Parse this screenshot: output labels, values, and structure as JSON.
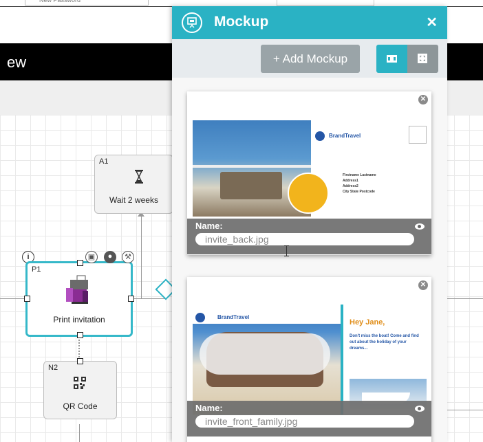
{
  "topbar": {
    "field_fragment": "New Password"
  },
  "background_view": {
    "title_fragment": "ew"
  },
  "nodes": {
    "wait": {
      "code": "A1",
      "label": "Wait 2 weeks"
    },
    "print": {
      "code": "P1",
      "label": "Print invitation"
    },
    "qr": {
      "code": "N2",
      "label": "QR Code"
    }
  },
  "panel": {
    "title": "Mockup",
    "close_glyph": "✕",
    "add_button": "+ Add Mockup",
    "cards": [
      {
        "name_label": "Name:",
        "name_value": "invite_back.jpg",
        "postcard_text": {
          "brand": "BrandTravel",
          "address_lines": [
            "Firstname Lastname",
            "Address1",
            "Address2",
            "City State Postcode"
          ]
        }
      },
      {
        "name_label": "Name:",
        "name_value": "invite_front_family.jpg",
        "postcard_text": {
          "brand": "BrandTravel",
          "greeting": "Hey Jane,",
          "body": "Don't miss the boat! Come and find out about the holiday of your dreams..."
        }
      }
    ]
  },
  "colors": {
    "accent": "#2ab2c4",
    "header_black": "#000000",
    "button_gray": "#9aa4a8"
  }
}
